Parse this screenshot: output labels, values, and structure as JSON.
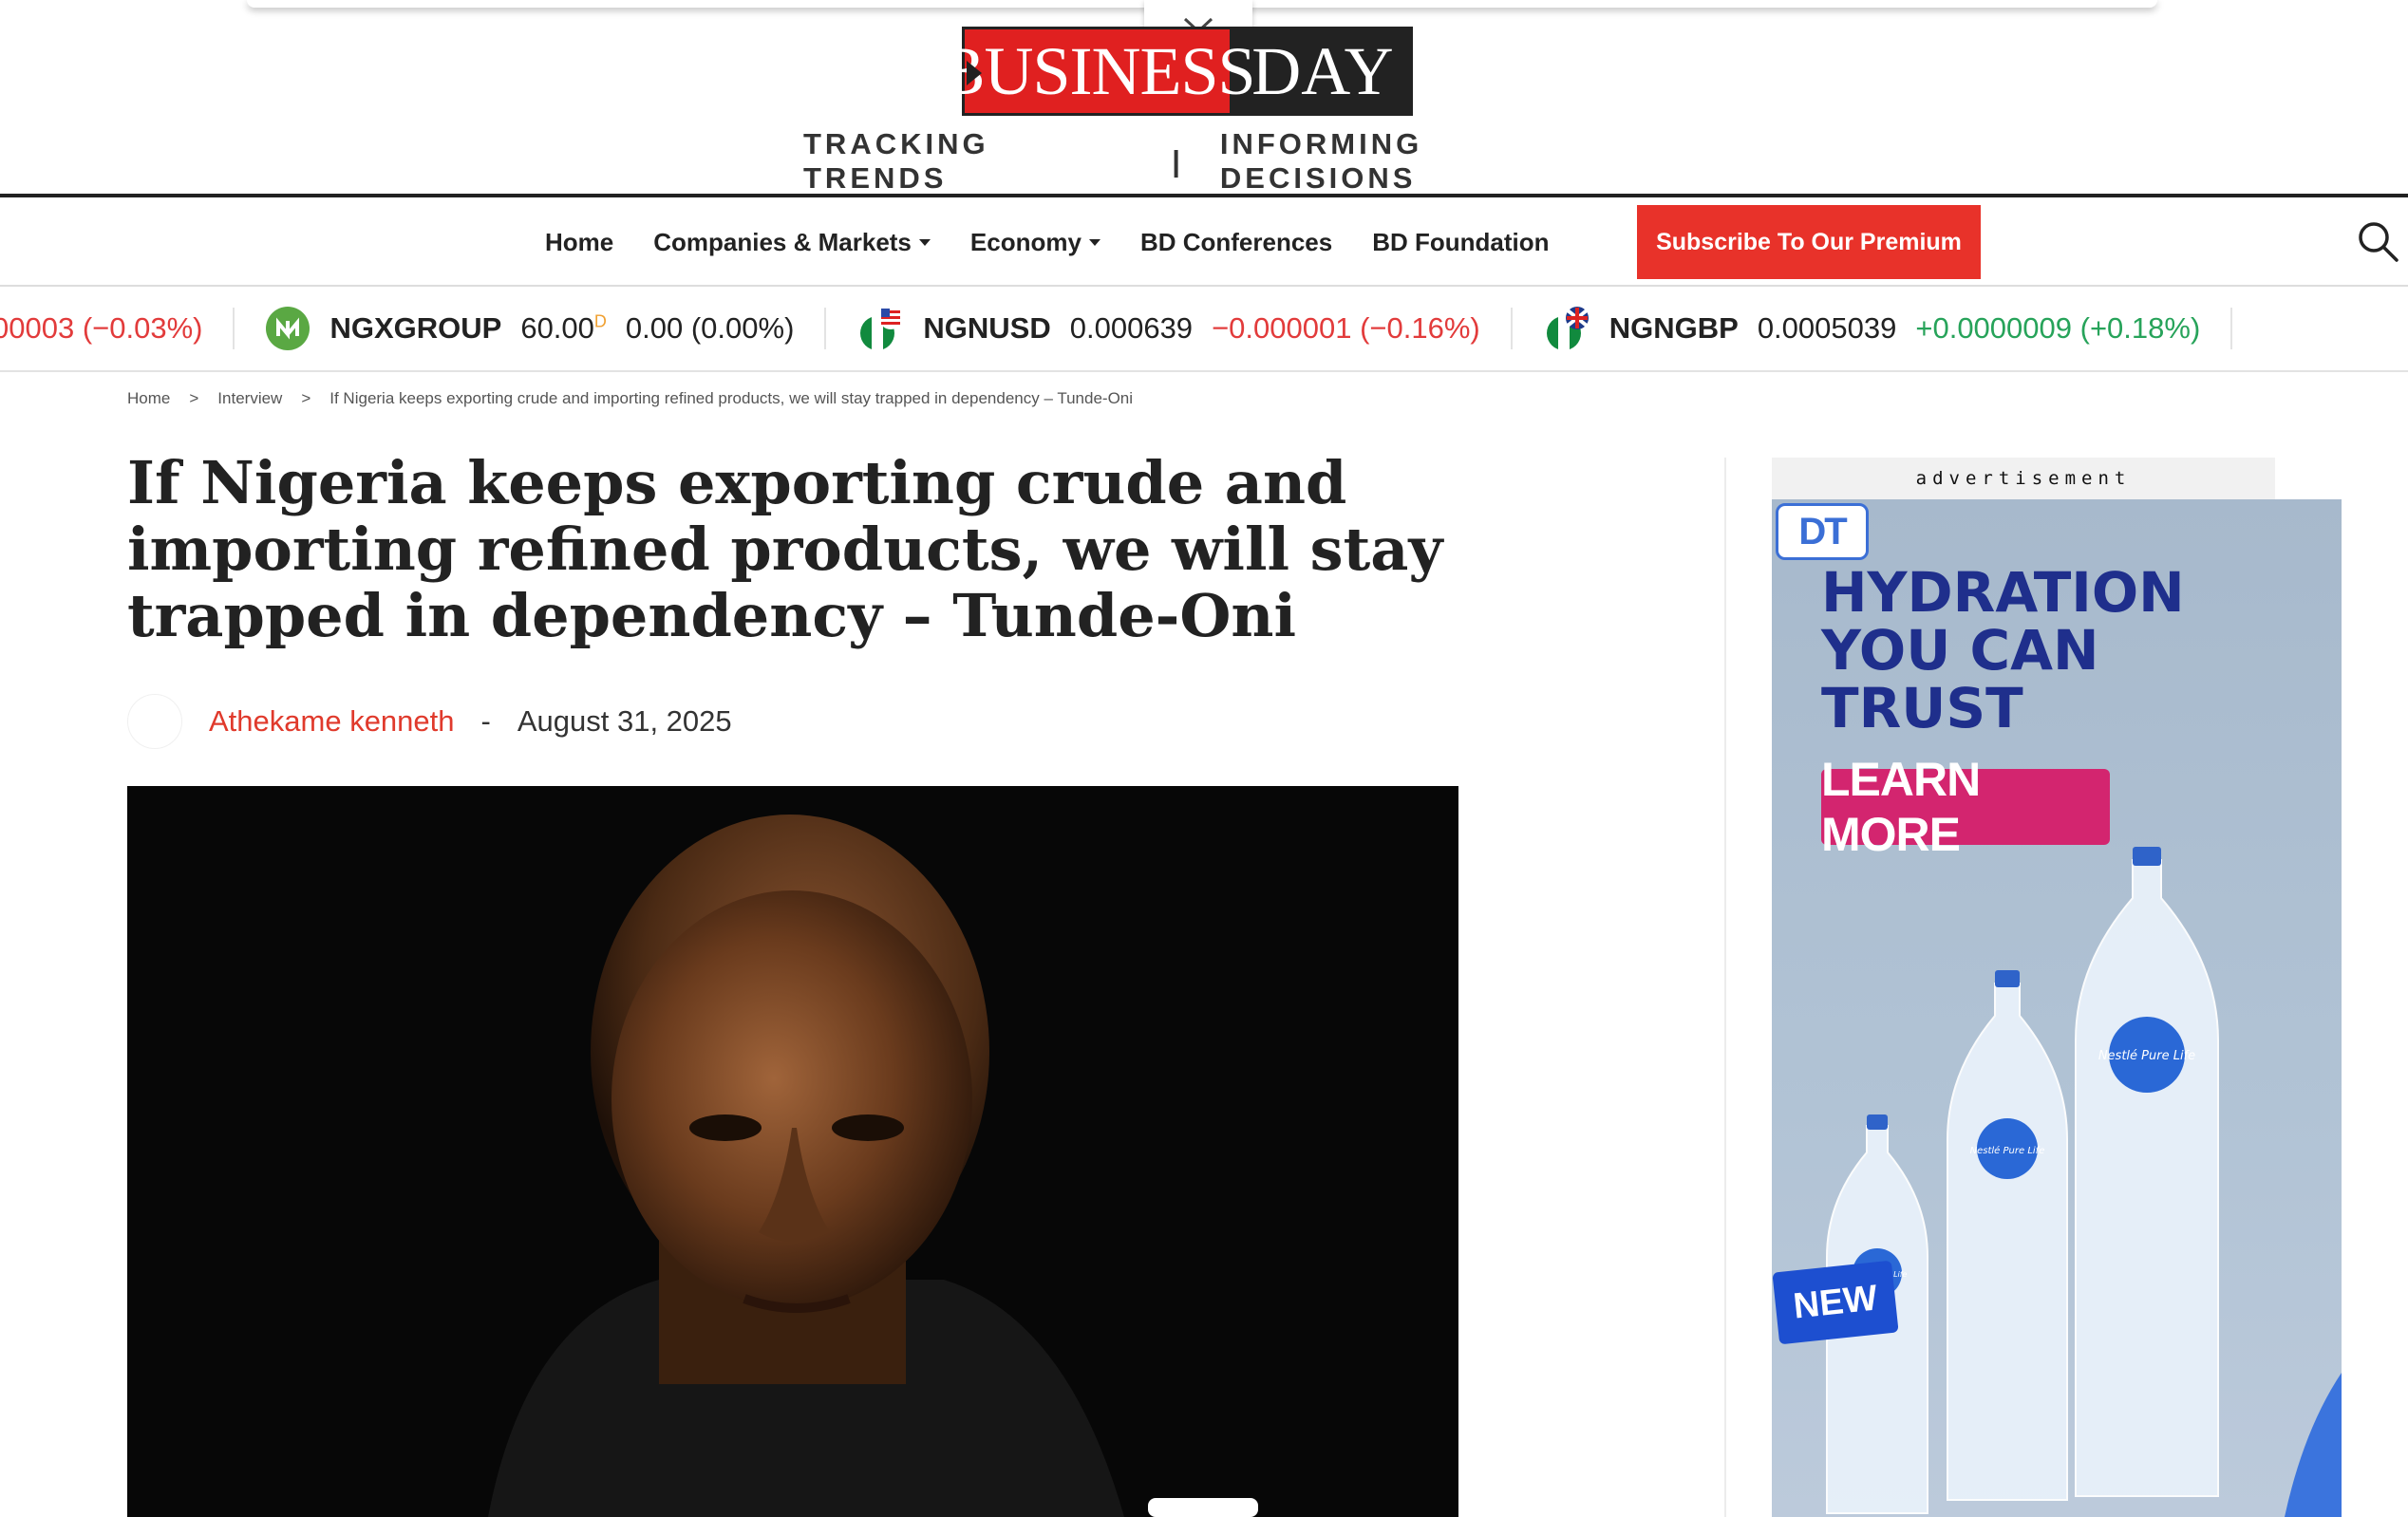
{
  "header": {
    "logo_business": "BUSINESS",
    "logo_day": "DAY",
    "tagline_left": "TRACKING TRENDS",
    "tagline_sep": "|",
    "tagline_right": "INFORMING DECISIONS"
  },
  "nav": {
    "items": [
      {
        "label": "Home",
        "dropdown": false
      },
      {
        "label": "Companies & Markets",
        "dropdown": true
      },
      {
        "label": "Economy",
        "dropdown": true
      },
      {
        "label": "BD Conferences",
        "dropdown": false
      },
      {
        "label": "BD Foundation",
        "dropdown": false
      }
    ],
    "subscribe_label": "Subscribe To Our Premium",
    "search_icon": "search-icon"
  },
  "ticker": {
    "partial_change": "00003 (−0.03%)",
    "items": [
      {
        "symbol": "NGXGROUP",
        "price": "60.00",
        "sup": "D",
        "change": "0.00 (0.00%)",
        "direction": "flat"
      },
      {
        "symbol": "NGNUSD",
        "price": "0.000639",
        "change": "−0.000001 (−0.16%)",
        "direction": "down"
      },
      {
        "symbol": "NGNGBP",
        "price": "0.0005039",
        "change": "+0.0000009 (+0.18%)",
        "direction": "up"
      }
    ]
  },
  "breadcrumb": {
    "home": "Home",
    "sep": ">",
    "section": "Interview",
    "current": "If Nigeria keeps exporting crude and importing refined products, we will stay trapped in dependency – Tunde-Oni"
  },
  "article": {
    "headline": "If Nigeria keeps exporting crude and importing refined products, we will stay trapped in dependency – Tunde-Oni",
    "author": "Athekame kenneth",
    "separator": "-",
    "date": "August 31, 2025"
  },
  "ad": {
    "label": "advertisement",
    "logo_text": "DT",
    "headline": "HYDRATION YOU CAN TRUST",
    "button": "LEARN MORE",
    "badge": "NEW",
    "bottle_brand": "Nestlé Pure Life"
  },
  "colors": {
    "brand_red": "#e02020",
    "subscribe_red": "#e8322a",
    "author_red": "#e03a2c",
    "negative": "#e23b3b",
    "positive": "#27a35a"
  }
}
